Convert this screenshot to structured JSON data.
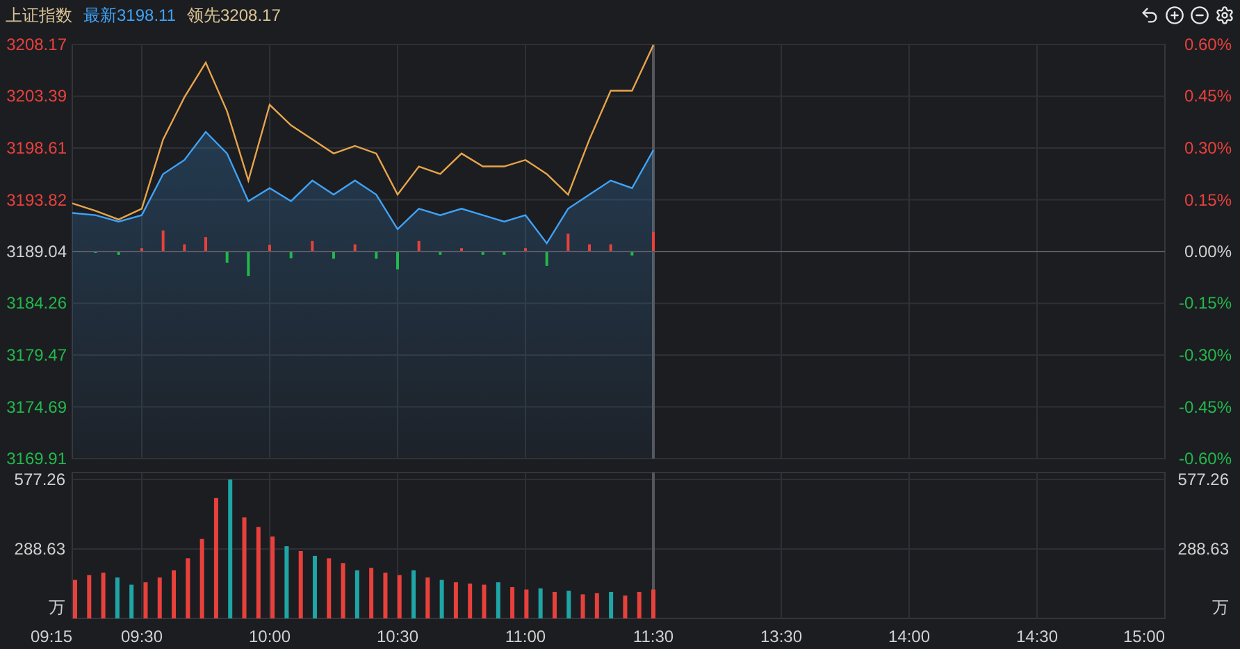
{
  "header": {
    "index_name": "上证指数",
    "latest_value": "3198.11",
    "leading_value": "3208.17"
  },
  "price_chart": {
    "right_axis": [
      {
        "label": "0.60%",
        "kind": "up"
      },
      {
        "label": "0.45%",
        "kind": "up"
      },
      {
        "label": "0.30%",
        "kind": "up"
      },
      {
        "label": "0.15%",
        "kind": "up"
      },
      {
        "label": "0.00%",
        "kind": "flat"
      },
      {
        "label": "-0.15%",
        "kind": "down"
      },
      {
        "label": "-0.30%",
        "kind": "down"
      },
      {
        "label": "-0.45%",
        "kind": "down"
      },
      {
        "label": "-0.60%",
        "kind": "down"
      }
    ],
    "chart_data": {
      "type": "line",
      "series": [
        {
          "name": "领先",
          "color": "#e8a54b",
          "values": [
            3193.5,
            3192.8,
            3192.0,
            3193.0,
            3199.4,
            3203.3,
            3206.5,
            3202.0,
            3195.6,
            3202.6,
            3200.7,
            3199.4,
            3198.1,
            3198.8,
            3198.1,
            3194.3,
            3196.9,
            3196.2,
            3198.1,
            3196.9,
            3196.9,
            3197.5,
            3196.2,
            3194.3,
            3199.4,
            3203.9,
            3203.9,
            3208.1
          ]
        },
        {
          "name": "最新",
          "color": "#3fa2f5",
          "values": [
            3192.6,
            3192.4,
            3191.8,
            3192.4,
            3196.2,
            3197.5,
            3200.1,
            3198.1,
            3193.7,
            3194.9,
            3193.7,
            3195.6,
            3194.3,
            3195.6,
            3194.3,
            3191.1,
            3193.0,
            3192.4,
            3193.0,
            3192.4,
            3191.8,
            3192.4,
            3189.8,
            3193.0,
            3194.3,
            3195.6,
            3194.9,
            3198.4
          ]
        }
      ],
      "ylim": [
        3169.91,
        3208.17
      ],
      "yticks": [
        {
          "value": 3208.17,
          "label": "3208.17"
        },
        {
          "value": 3203.39,
          "label": "3203.39"
        },
        {
          "value": 3198.61,
          "label": "3198.61"
        },
        {
          "value": 3193.82,
          "label": "3193.82"
        },
        {
          "value": 3189.04,
          "label": "3189.04"
        },
        {
          "value": 3184.26,
          "label": "3184.26"
        },
        {
          "value": 3179.47,
          "label": "3179.47"
        },
        {
          "value": 3174.69,
          "label": "3174.69"
        },
        {
          "value": 3169.91,
          "label": "3169.91"
        }
      ]
    }
  },
  "volume_chart": {
    "unit": "万",
    "right_axis": [
      "577.26",
      "288.63",
      "万"
    ],
    "chart_data": {
      "type": "bar",
      "stacked": true,
      "categories": [
        null,
        null,
        null,
        null,
        null,
        null,
        null,
        null,
        null,
        null,
        null,
        null,
        null,
        null,
        null,
        null,
        null,
        null,
        null,
        null,
        null,
        null,
        null,
        null,
        null,
        null,
        null,
        null,
        null,
        null,
        null,
        null,
        null,
        null,
        null,
        null,
        null,
        null,
        null,
        null,
        null,
        null
      ],
      "series": [
        {
          "color": "#e8413c",
          "values": [
            160,
            180,
            190,
            null,
            null,
            150,
            170,
            200,
            250,
            330,
            500,
            null,
            420,
            380,
            340,
            null,
            280,
            null,
            250,
            230,
            null,
            210,
            190,
            180,
            null,
            170,
            null,
            150,
            145,
            140,
            null,
            130,
            120,
            null,
            110,
            null,
            100,
            105,
            null,
            95,
            110,
            120
          ]
        },
        {
          "color": "#1fa5a5",
          "values": [
            null,
            null,
            null,
            170,
            140,
            null,
            null,
            null,
            null,
            null,
            null,
            577,
            null,
            null,
            null,
            300,
            null,
            260,
            null,
            null,
            200,
            null,
            null,
            null,
            200,
            null,
            160,
            null,
            null,
            null,
            150,
            null,
            null,
            125,
            null,
            115,
            null,
            null,
            110,
            null,
            null,
            null
          ]
        }
      ],
      "ylim": [
        0,
        577.26
      ],
      "yticks": [
        {
          "value": 577.26,
          "label": "577.26"
        },
        {
          "value": 288.63,
          "label": "288.63"
        }
      ]
    }
  },
  "time_axis": [
    "09:15",
    "09:30",
    "10:00",
    "10:30",
    "11:00",
    "11:30",
    "13:30",
    "14:00",
    "14:30",
    "15:00"
  ]
}
